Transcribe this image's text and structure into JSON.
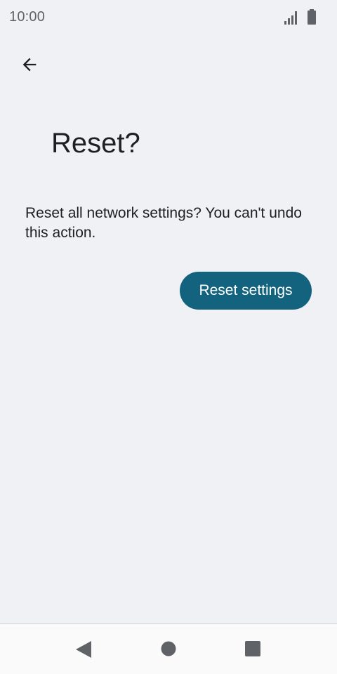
{
  "status_bar": {
    "time": "10:00",
    "icons": [
      "signal-icon",
      "battery-icon"
    ]
  },
  "header": {
    "back_icon": "arrow-left-icon"
  },
  "page": {
    "title": "Reset?",
    "message": "Reset all network settings? You can't undo this action.",
    "reset_button_label": "Reset settings"
  },
  "nav_bar": {
    "icons": [
      "nav-back-icon",
      "nav-home-icon",
      "nav-recents-icon"
    ]
  },
  "colors": {
    "background": "#eff1f4",
    "accent": "#14637e",
    "text": "#1d1f22",
    "nav_background": "#fafafa"
  }
}
